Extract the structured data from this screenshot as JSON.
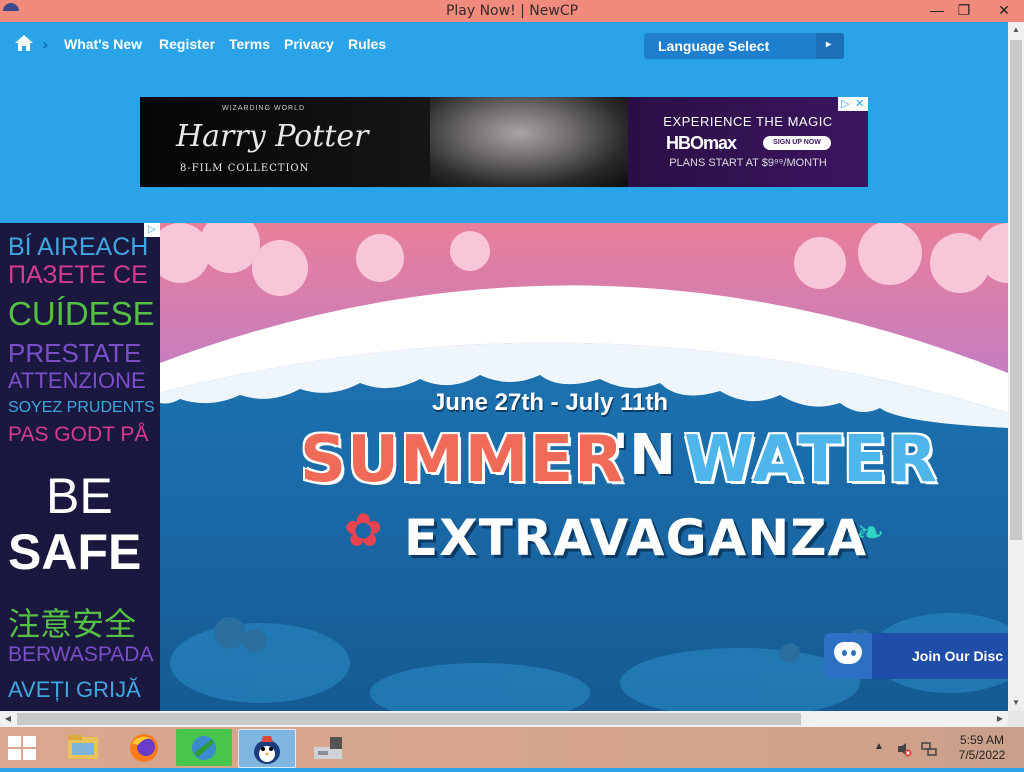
{
  "window": {
    "title": "Play Now! | NewCP",
    "minimize": "—",
    "restore": "❐",
    "close": "✕"
  },
  "nav": {
    "chevron": "›",
    "links": [
      "What's New",
      "Register",
      "Terms",
      "Privacy",
      "Rules"
    ],
    "language_select": "Language Select",
    "language_arrow": "▸"
  },
  "banner_ad": {
    "world": "WIZARDING WORLD",
    "title": "Harry Potter",
    "subtitle": "8-FILM COLLECTION",
    "headline": "EXPERIENCE THE MAGIC",
    "brand": "HBOmax",
    "cta": "SIGN UP NOW",
    "price": "PLANS START AT $9⁹⁹/MONTH",
    "adchoices": [
      "▷",
      "✕"
    ]
  },
  "side_ad": {
    "lines": [
      "BÍ AIREACH",
      "ПАЗЕТЕ СЕ",
      "CUÍDESE",
      "PRESTATE",
      "ATTENZIONE",
      "SOYEZ PRUDENTS",
      "PAS GODT PÅ",
      "BE",
      "SAFE",
      "注意安全",
      "BERWASPADA",
      "AVEȚI GRIJĂ"
    ],
    "colors": [
      "#3fa7e0",
      "#d63b8f",
      "#55c043",
      "#7a4fc9",
      "#7a4fc9",
      "#3fa7e0",
      "#d63b8f",
      "#ffffff",
      "#ffffff",
      "#55c043",
      "#7a4fc9",
      "#3fa7e0"
    ],
    "adchoice": "▷"
  },
  "hero": {
    "dates": "June 27th - July 11th",
    "word1": "SUMMER",
    "word2": "'N",
    "word3": "WATER",
    "word4": "EXTRAVAGANZA",
    "hibiscus": "✿",
    "leaf": "❧"
  },
  "discord": {
    "label": "Join Our Disc"
  },
  "scrollbars": {
    "up": "▲",
    "down": "▼",
    "left": "◀",
    "right": "▶"
  },
  "taskbar": {
    "apps": [
      "file-explorer",
      "firefox",
      "network-app",
      "club-penguin-app",
      "usb-drive"
    ],
    "tray_chevron": "▲",
    "time": "5:59 AM",
    "date": "7/5/2022"
  },
  "colors": {
    "page_bg": "#2aa3e8",
    "titlebar": "#f08a7d",
    "lang_btn": "#1e7fcf"
  }
}
